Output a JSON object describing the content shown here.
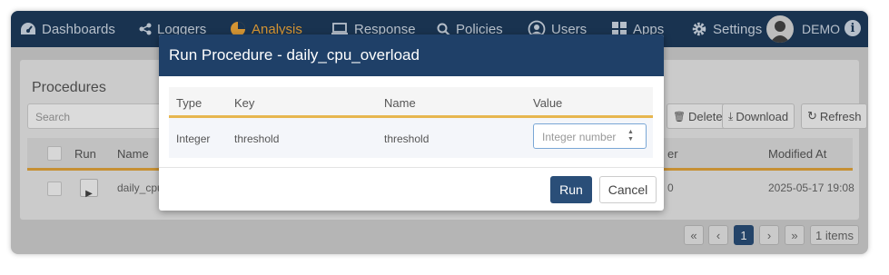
{
  "nav": {
    "items": [
      {
        "label": "Dashboards",
        "icon": "dashboard-gauge-icon"
      },
      {
        "label": "Loggers",
        "icon": "share-nodes-icon"
      },
      {
        "label": "Analysis",
        "icon": "pie-chart-icon",
        "active": true
      },
      {
        "label": "Response",
        "icon": "laptop-icon"
      },
      {
        "label": "Policies",
        "icon": "search-icon"
      },
      {
        "label": "Users",
        "icon": "user-circle-icon"
      },
      {
        "label": "Apps",
        "icon": "grid-icon"
      },
      {
        "label": "Settings",
        "icon": "gear-icon"
      }
    ],
    "user": "DEMO",
    "info_glyph": "i"
  },
  "page": {
    "title": "Procedures",
    "search_placeholder": "Search",
    "delete_label": "Delete",
    "download_label": "Download",
    "refresh_label": "Refresh",
    "columns": [
      "Run",
      "Name",
      "er",
      "Modified At"
    ],
    "rows": [
      {
        "name": "daily_cpu_o",
        "count": "0",
        "modified_at": "2025-05-17 19:08"
      }
    ],
    "pager": {
      "first": "«",
      "prev": "‹",
      "current": "1",
      "next": "›",
      "last": "»",
      "items": "1 items"
    }
  },
  "modal": {
    "title": "Run Procedure - daily_cpu_overload",
    "columns": [
      "Type",
      "Key",
      "Name",
      "Value"
    ],
    "row": {
      "type": "Integer",
      "key": "threshold",
      "name": "threshold",
      "value_placeholder": "Integer number"
    },
    "run_label": "Run",
    "cancel_label": "Cancel"
  },
  "colors": {
    "nav_bg": "#1d3b5c",
    "accent_orange": "#f2a93b",
    "modal_header": "#1f4068",
    "primary_button": "#2a4e78"
  }
}
